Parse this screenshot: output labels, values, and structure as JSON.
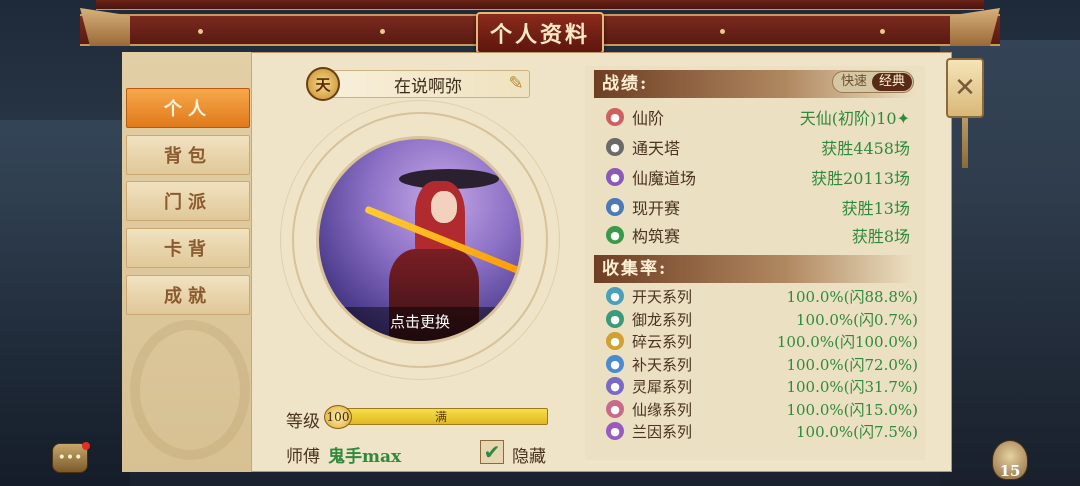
{
  "title": "个人资料",
  "tabs": [
    {
      "label": "个人",
      "active": true
    },
    {
      "label": "背包",
      "active": false
    },
    {
      "label": "门派",
      "active": false
    },
    {
      "label": "卡背",
      "active": false
    },
    {
      "label": "成就",
      "active": false
    }
  ],
  "profile": {
    "badge": "天",
    "name": "在说啊弥",
    "change_avatar": "点击更换",
    "level_label": "等级",
    "level_value": "100",
    "level_state": "满",
    "master_label": "师傅",
    "master_name": "鬼手max",
    "hide_label": "隐藏",
    "hide_checked": true
  },
  "record": {
    "title": "战绩:",
    "toggle_fast": "快速",
    "toggle_classic": "经典",
    "rows": [
      {
        "name": "仙阶",
        "value": "天仙(初阶)10✦",
        "icon_color": "#d06060"
      },
      {
        "name": "通天塔",
        "value": "获胜4458场",
        "icon_color": "#6a6a6a"
      },
      {
        "name": "仙魔道场",
        "value": "获胜20113场",
        "icon_color": "#8a5ab8"
      },
      {
        "name": "现开赛",
        "value": "获胜13场",
        "icon_color": "#4a7ab8"
      },
      {
        "name": "构筑赛",
        "value": "获胜8场",
        "icon_color": "#3a9a4a"
      }
    ]
  },
  "collection": {
    "title": "收集率:",
    "rows": [
      {
        "name": "开天系列",
        "value": "100.0%(闪88.8%)",
        "icon_color": "#4aa0b8"
      },
      {
        "name": "御龙系列",
        "value": "100.0%(闪0.7%)",
        "icon_color": "#3a9a7a"
      },
      {
        "name": "碎云系列",
        "value": "100.0%(闪100.0%)",
        "icon_color": "#d0a030"
      },
      {
        "name": "补天系列",
        "value": "100.0%(闪72.0%)",
        "icon_color": "#4a8ad0"
      },
      {
        "name": "灵犀系列",
        "value": "100.0%(闪31.7%)",
        "icon_color": "#7a6ac8"
      },
      {
        "name": "仙缘系列",
        "value": "100.0%(闪15.0%)",
        "icon_color": "#c86a8a"
      },
      {
        "name": "兰因系列",
        "value": "100.0%(闪7.5%)",
        "icon_color": "#9a5ac0"
      }
    ]
  },
  "bag_count": "15",
  "icons": {
    "close": "close-icon",
    "chat": "chat-icon",
    "edit": "edit-icon",
    "bag": "bag-icon"
  },
  "colors": {
    "accent": "#e07a1c",
    "value_green": "#2e8a3c",
    "header_brown": "#6e3e24"
  }
}
